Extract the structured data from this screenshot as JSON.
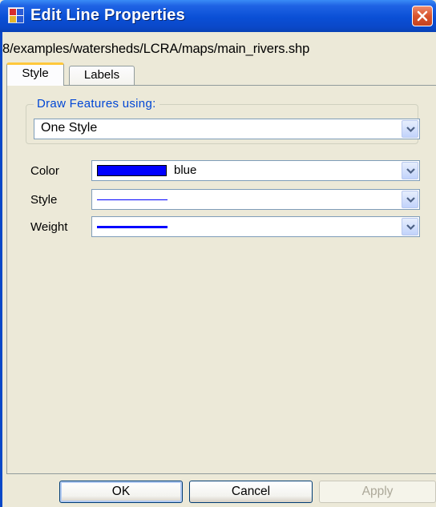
{
  "window": {
    "title": "Edit Line Properties",
    "path": "8/examples/watersheds/LCRA/maps/main_rivers.shp"
  },
  "tabs": [
    {
      "label": "Style",
      "active": true
    },
    {
      "label": "Labels",
      "active": false
    }
  ],
  "draw_features": {
    "legend": "Draw Features using:",
    "selected": "One Style"
  },
  "fields": {
    "color": {
      "label": "Color",
      "value": "blue",
      "swatch": "#0000ff"
    },
    "style": {
      "label": "Style"
    },
    "weight": {
      "label": "Weight"
    }
  },
  "buttons": {
    "ok": "OK",
    "cancel": "Cancel",
    "apply": "Apply"
  },
  "icons": {
    "app": "app-grid-icon",
    "close": "close-icon",
    "dropdown": "chevron-down-icon"
  },
  "colors": {
    "title_bar": "#0a48c8",
    "close_button": "#d8542d",
    "legend_text": "#0046d5",
    "line_color": "#0000ff"
  }
}
